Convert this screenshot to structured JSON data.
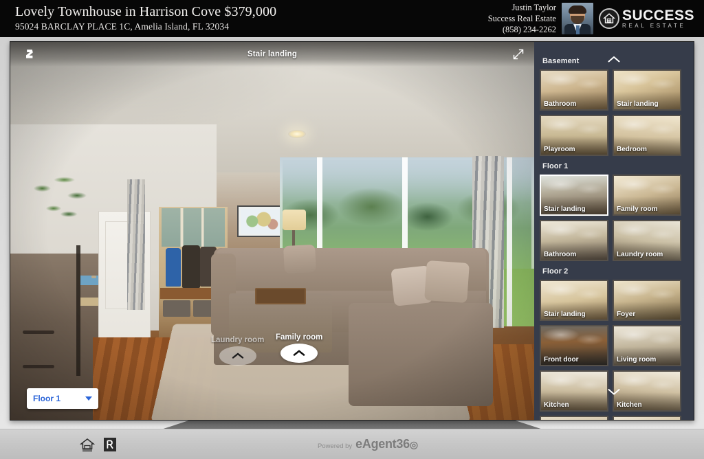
{
  "header": {
    "property_title": "Lovely Townhouse in Harrison Cove $379,000",
    "property_address": "95024 BARCLAY PLACE 1C, Amelia Island, FL 32034",
    "agent_name": "Justin Taylor",
    "agent_company": "Success Real Estate",
    "agent_phone": "(858) 234-2262",
    "headshot_alt": "agent-headshot",
    "brand_logo_main": "SUCCESS",
    "brand_logo_sub": "REAL ESTATE",
    "brand_logo_icon": "house-in-circle-icon",
    "background_color": "#070707"
  },
  "viewer": {
    "scene_title": "Stair landing",
    "stairs_icon": "stairs-house-icon",
    "expand_icon": "expand-fullscreen-icon",
    "floor_selector": {
      "selected": "Floor 1",
      "caret_icon": "chevron-down-icon",
      "accent_color": "#2a64d8",
      "options": [
        "Basement",
        "Floor 1",
        "Floor 2"
      ]
    },
    "hotspots": [
      {
        "label": "Laundry room",
        "state": "dim",
        "icon": "chevron-up-arrow-icon"
      },
      {
        "label": "Family room",
        "state": "active",
        "icon": "chevron-up-arrow-icon"
      }
    ]
  },
  "sidebar": {
    "background_color": "#363c4a",
    "scroll_up_icon": "chevron-up-icon",
    "scroll_down_icon": "chevron-down-icon",
    "groups": [
      {
        "title": "Basement",
        "thumbs": [
          {
            "label": "Bathroom",
            "selected": false,
            "style": "ti-a"
          },
          {
            "label": "Stair landing",
            "selected": false,
            "style": "ti-b"
          },
          {
            "label": "Playroom",
            "selected": false,
            "style": "ti-c"
          },
          {
            "label": "Bedroom",
            "selected": false,
            "style": "ti-d"
          }
        ]
      },
      {
        "title": "Floor 1",
        "thumbs": [
          {
            "label": "Stair landing",
            "selected": true,
            "style": "ti-e"
          },
          {
            "label": "Family room",
            "selected": false,
            "style": "ti-f"
          },
          {
            "label": "Bathroom",
            "selected": false,
            "style": "ti-g"
          },
          {
            "label": "Laundry room",
            "selected": false,
            "style": "ti-h"
          }
        ]
      },
      {
        "title": "Floor 2",
        "thumbs": [
          {
            "label": "Stair landing",
            "selected": false,
            "style": "ti-i"
          },
          {
            "label": "Foyer",
            "selected": false,
            "style": "ti-j"
          },
          {
            "label": "Front door",
            "selected": false,
            "style": "ti-k"
          },
          {
            "label": "Living room",
            "selected": false,
            "style": "ti-l"
          },
          {
            "label": "Kitchen",
            "selected": false,
            "style": "ti-m"
          },
          {
            "label": "Kitchen",
            "selected": false,
            "style": "ti-n"
          },
          {
            "label": "",
            "selected": false,
            "style": "ti-o"
          },
          {
            "label": "",
            "selected": false,
            "style": "ti-p"
          }
        ]
      }
    ]
  },
  "footer": {
    "equal_housing_icon": "equal-housing-opportunity-icon",
    "realtor_icon": "realtor-logo-icon",
    "powered_by": "Powered by",
    "brand": "eAgent36",
    "brand_ring": "◎"
  }
}
